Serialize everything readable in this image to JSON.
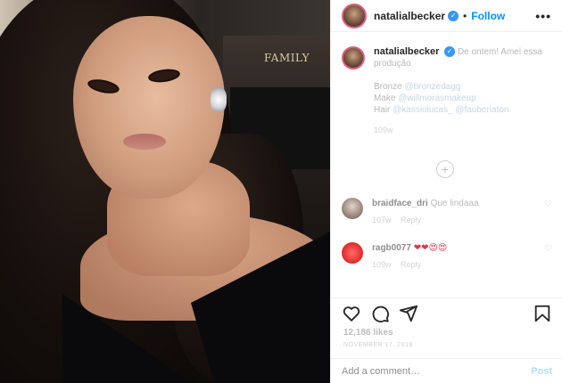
{
  "photo": {
    "wall_text": "FAMILY"
  },
  "header": {
    "username": "natalialbecker",
    "verified_mark": "✓",
    "separator": "•",
    "follow_label": "Follow",
    "more_label": "•••"
  },
  "caption": {
    "username": "natalialbecker",
    "text": "De ontem! Amei essa produção",
    "line2": "Bronze",
    "tag2": "@bronzedagg",
    "line3": "Make",
    "tag3": "@willmorasmakeup",
    "line4": "Hair",
    "tag4": "@kassiolucas_ @fauberiaton",
    "time": "109w"
  },
  "load_more_label": "+",
  "comments": [
    {
      "username": "braidface_dri",
      "text": "Que lindaaa",
      "time": "107w",
      "reply": "Reply"
    },
    {
      "username": "ragb0077",
      "text": "❤❤😍😍",
      "time": "109w",
      "reply": "Reply"
    }
  ],
  "likes": "12,186 likes",
  "date": "NOVEMBER 17, 2018",
  "add_comment": {
    "placeholder": "Add a comment…",
    "post_label": "Post"
  },
  "icons": {
    "heart": "heart-icon",
    "comment": "comment-icon",
    "share": "share-icon",
    "save": "bookmark-icon"
  },
  "colors": {
    "accent": "#0095f6",
    "story_ring": "#e35d84"
  }
}
